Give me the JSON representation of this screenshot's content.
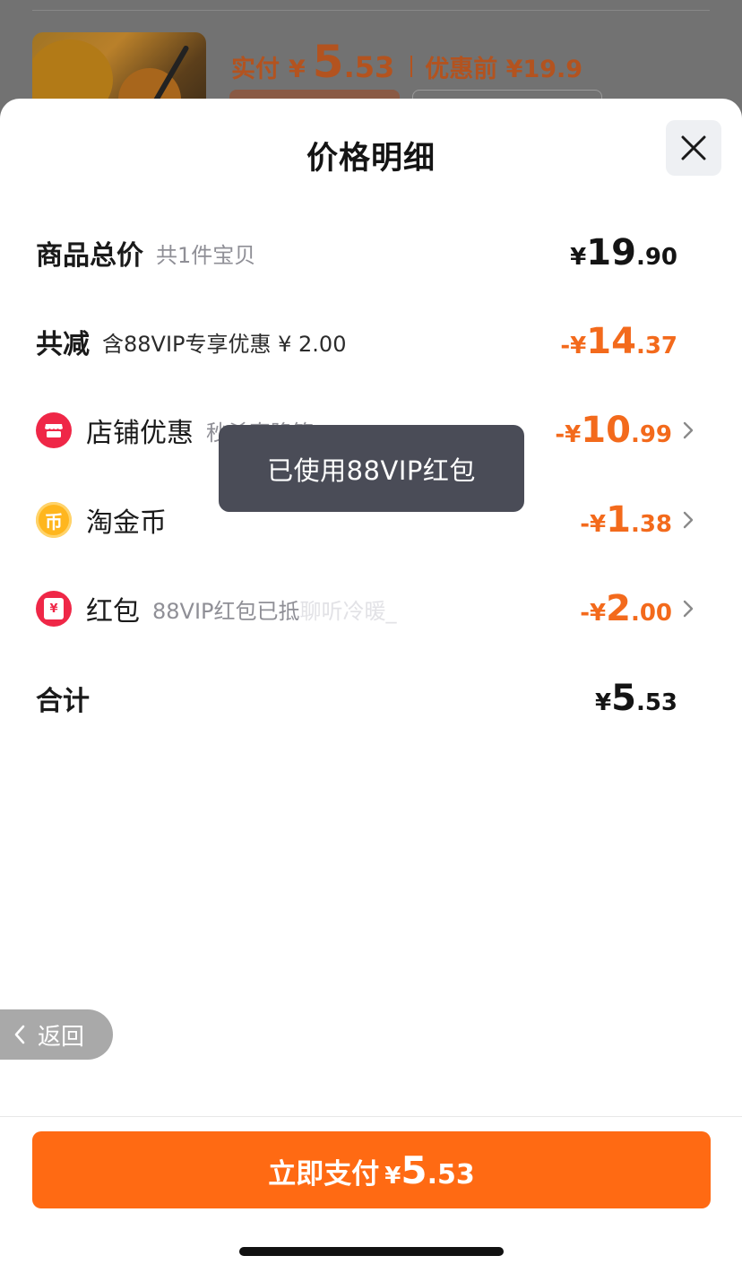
{
  "background": {
    "paid_label": "实付",
    "currency": "¥",
    "paid_int": "5",
    "paid_dec": ".53",
    "original_price": "优惠前 ¥19.9"
  },
  "sheet": {
    "title": "价格明细",
    "close_icon": "close-icon"
  },
  "rows": {
    "total": {
      "label": "商品总价",
      "sub": "共1件宝贝",
      "sign": "",
      "currency": "¥",
      "int": "19",
      "dec": ".90"
    },
    "discount": {
      "label": "共减",
      "sub": "含88VIP专享优惠 ¥ 2.00",
      "sign": "-",
      "currency": "¥",
      "int": "14",
      "dec": ".37"
    },
    "shop": {
      "label": "店铺优惠",
      "sub": "秒杀直降等",
      "sign": "-",
      "currency": "¥",
      "int": "10",
      "dec": ".99",
      "icon": "shop-icon"
    },
    "coins": {
      "label": "淘金币",
      "sign": "-",
      "currency": "¥",
      "int": "1",
      "dec": ".38",
      "icon": "coin-icon",
      "icon_char": "币"
    },
    "redpacket": {
      "label": "红包",
      "sub": "88VIP红包已抵",
      "watermark": "聊听冷暖_",
      "sign": "-",
      "currency": "¥",
      "int": "2",
      "dec": ".00",
      "icon": "red-packet-icon",
      "icon_char": "¥"
    },
    "sum": {
      "label": "合计",
      "currency": "¥",
      "int": "5",
      "dec": ".53"
    }
  },
  "toast": {
    "text": "已使用88VIP红包"
  },
  "back_button": {
    "label": "返回",
    "icon": "chevron-left-icon"
  },
  "pay_button": {
    "label": "立即支付",
    "currency": "¥",
    "int": "5",
    "dec": ".53"
  },
  "colors": {
    "accent": "#ff6a13",
    "discount_text": "#f36a1c",
    "toast_bg": "#4a4c57",
    "shop_icon": "#ef2747",
    "coin_icon": "#ffb61e"
  }
}
